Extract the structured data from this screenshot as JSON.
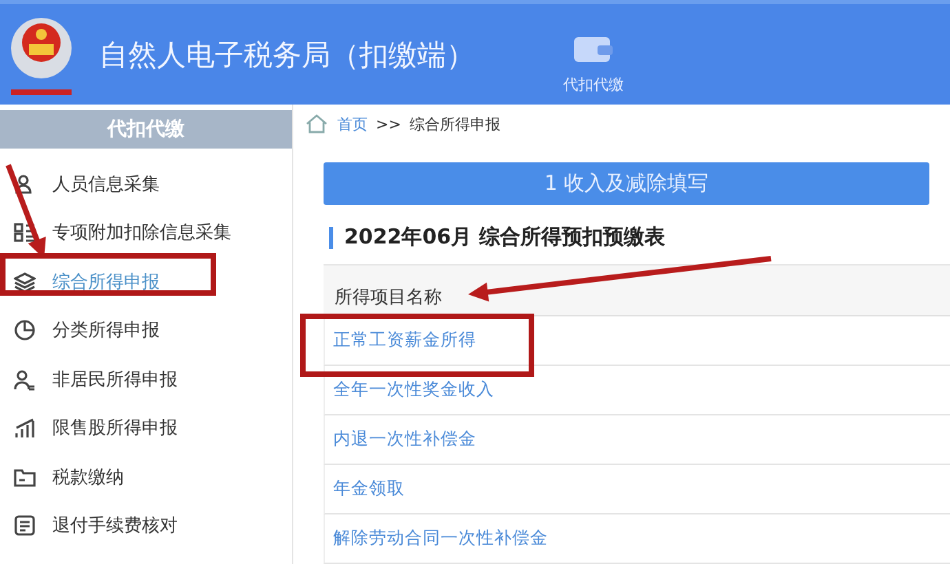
{
  "header": {
    "title": "自然人电子税务局（扣缴端）",
    "nav": [
      {
        "label": "代扣代缴",
        "selected": true
      }
    ]
  },
  "sidebar": {
    "title": "代扣代缴",
    "items": [
      {
        "label": "人员信息采集",
        "selected": false
      },
      {
        "label": "专项附加扣除信息采集",
        "selected": false
      },
      {
        "label": "综合所得申报",
        "selected": true
      },
      {
        "label": "分类所得申报",
        "selected": false
      },
      {
        "label": "非居民所得申报",
        "selected": false
      },
      {
        "label": "限售股所得申报",
        "selected": false
      },
      {
        "label": "税款缴纳",
        "selected": false
      },
      {
        "label": "退付手续费核对",
        "selected": false
      }
    ]
  },
  "breadcrumb": {
    "home": "首页",
    "separator": ">>",
    "current": "综合所得申报"
  },
  "step": {
    "label": "1 收入及减除填写"
  },
  "form_title": "2022年06月  综合所得预扣预缴表",
  "table": {
    "columns": [
      "所得项目名称"
    ],
    "rows": [
      "正常工资薪金所得",
      "全年一次性奖金收入",
      "内退一次性补偿金",
      "年金领取",
      "解除劳动合同一次性补偿金"
    ]
  },
  "annotations": [
    {
      "kind": "arrow"
    },
    {
      "kind": "box"
    },
    {
      "kind": "arrow"
    },
    {
      "kind": "box"
    }
  ]
}
